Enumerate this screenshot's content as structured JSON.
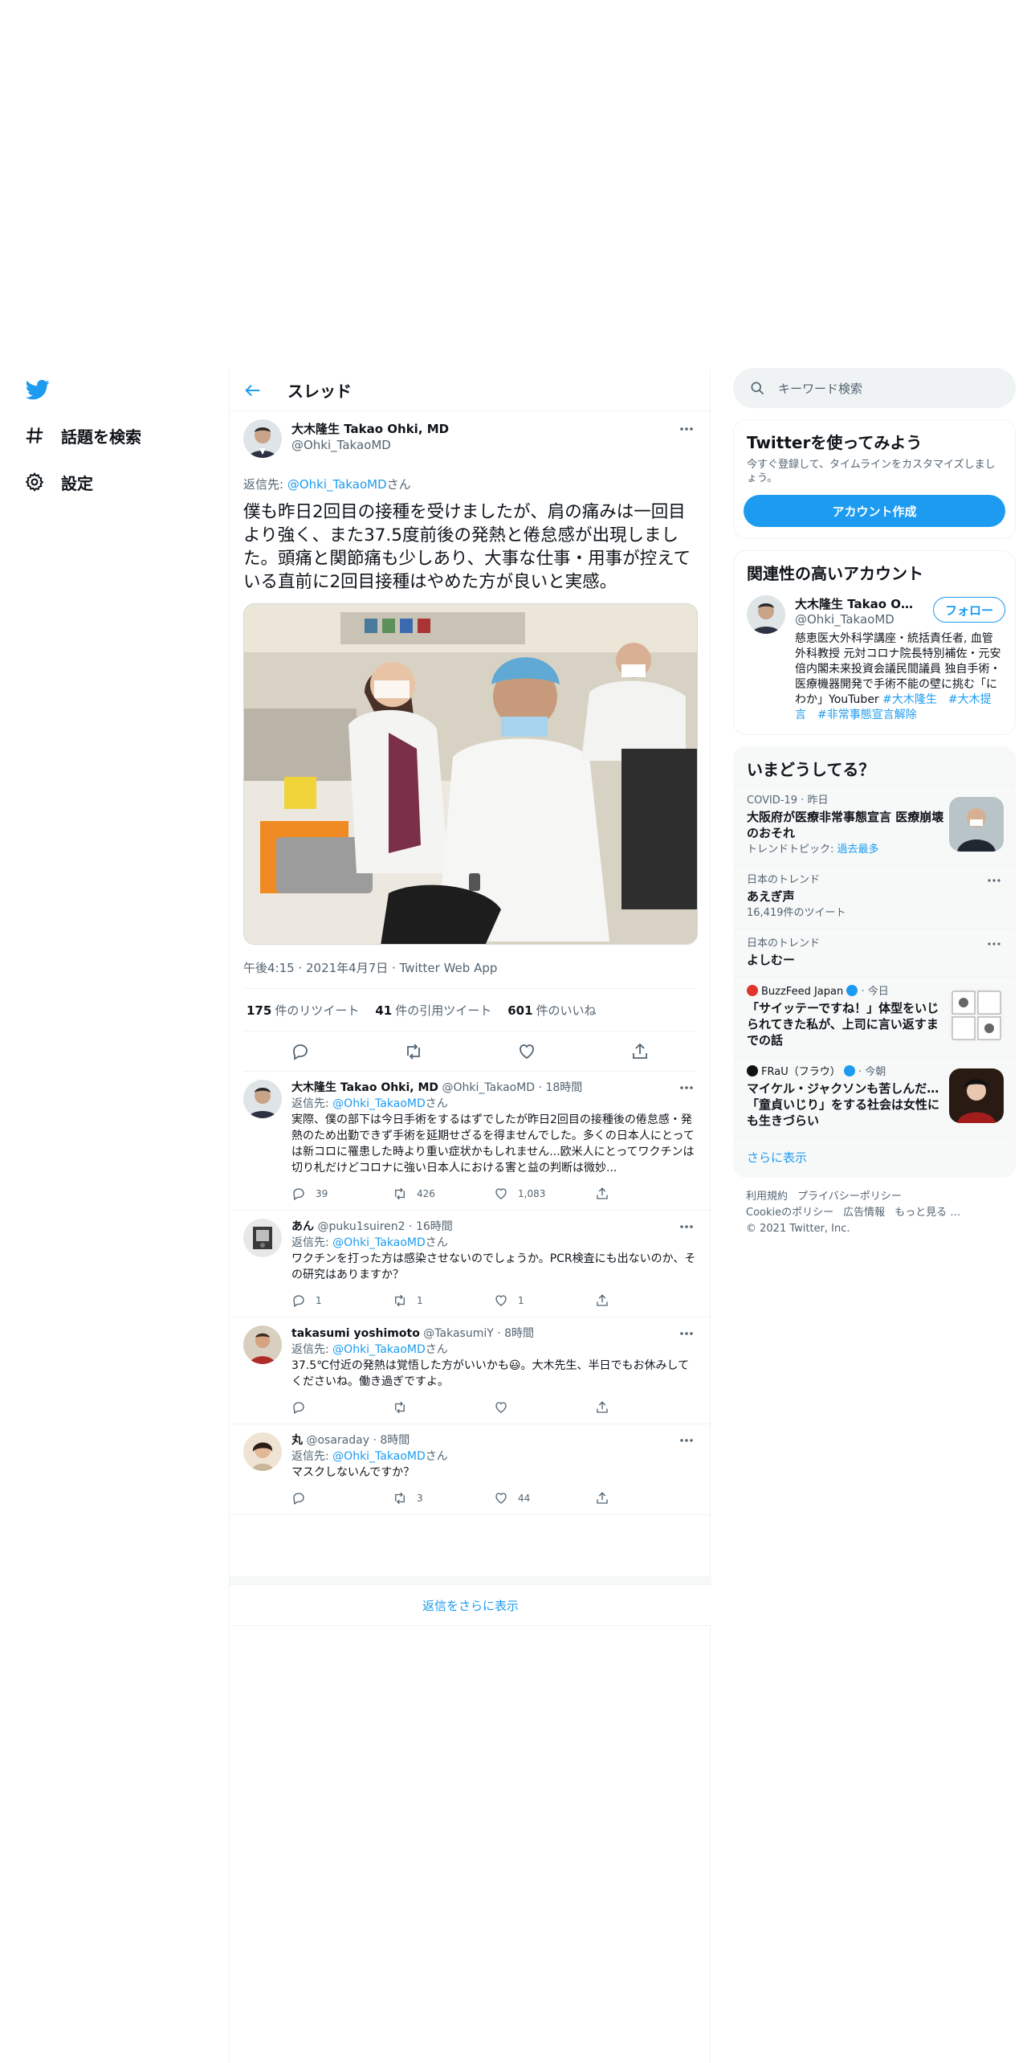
{
  "nav": {
    "items": [
      {
        "label": "話題を検索",
        "icon": "hashtag-icon"
      },
      {
        "label": "設定",
        "icon": "gear-icon"
      }
    ]
  },
  "header": {
    "title": "スレッド"
  },
  "main_tweet": {
    "display_name": "大木隆生 Takao Ohki, MD",
    "username": "@Ohki_TakaoMD",
    "reply_to_prefix": "返信先: ",
    "reply_to_user": "@Ohki_TakaoMD",
    "reply_to_suffix": "さん",
    "text": "僕も昨日2回目の接種を受けましたが、肩の痛みは一回目より強く、また37.5度前後の発熱と倦怠感が出現しました。頭痛と関節痛も少しあり、大事な仕事・用事が控えている直前に2回目接種はやめた方が良いと実感。",
    "meta": "午後4:15 · 2021年4月7日 · Twitter Web App",
    "retweets": "175",
    "retweets_label": "件のリツイート",
    "quotes": "41",
    "quotes_label": "件の引用ツイート",
    "likes": "601",
    "likes_label": "件のいいね"
  },
  "replies": [
    {
      "display_name": "大木隆生 Takao Ohki, MD",
      "username": "@Ohki_TakaoMD",
      "time": "18時間",
      "reply_to": "@Ohki_TakaoMD",
      "text": "実際、僕の部下は今日手術をするはずでしたが昨日2回目の接種後の倦怠感・発熱のため出勤できず手術を延期せざるを得ませんでした。多くの日本人にとっては新コロに罹患した時より重い症状かもしれません...欧米人にとってワクチンは切り札だけどコロナに強い日本人における害と益の判断は微妙...",
      "replies": "39",
      "retweets": "426",
      "likes": "1,083"
    },
    {
      "display_name": "あん",
      "username": "@puku1suiren2",
      "time": "16時間",
      "reply_to": "@Ohki_TakaoMD",
      "text": "ワクチンを打った方は感染させないのでしょうか。PCR検査にも出ないのか、その研究はありますか？",
      "replies": "1",
      "retweets": "1",
      "likes": "1"
    },
    {
      "display_name": "takasumi yoshimoto",
      "username": "@TakasumiY",
      "time": "8時間",
      "reply_to": "@Ohki_TakaoMD",
      "text": "37.5℃付近の発熱は覚悟した方がいいかも😃。大木先生、半日でもお休みしてくださいね。働き過ぎですよ。",
      "replies": "",
      "retweets": "",
      "likes": ""
    },
    {
      "display_name": "丸",
      "username": "@osaraday",
      "time": "8時間",
      "reply_to": "@Ohki_TakaoMD",
      "text": "マスクしないんですか？",
      "replies": "",
      "retweets": "3",
      "likes": "44"
    }
  ],
  "reply_to_prefix": "返信先: ",
  "reply_to_suffix": "さん",
  "show_more_replies": "返信をさらに表示",
  "search": {
    "placeholder": "キーワード検索"
  },
  "signup": {
    "title": "Twitterを使ってみよう",
    "text": "今すぐ登録して、タイムラインをカスタマイズしましょう。",
    "button": "アカウント作成"
  },
  "related": {
    "title": "関連性の高いアカウント",
    "display_name": "大木隆生 Takao Ohki...",
    "username": "@Ohki_TakaoMD",
    "follow": "フォロー",
    "bio": "慈恵医大外科学講座・統括責任者, 血管外科教授 元対コロナ院長特別補佐・元安倍内閣未来投資会議民間議員 独自手術・医療機器開発で手術不能の壁に挑む「にわか」YouTuber ",
    "hashtags": [
      "#大木隆生",
      "#大木提言",
      "#非常事態宣言解除"
    ]
  },
  "trends": {
    "title": "いまどうしてる？",
    "items": [
      {
        "category": "COVID-19 · 昨日",
        "title": "大阪府が医療非常事態宣言 医療崩壊のおそれ",
        "extra_prefix": "トレンドトピック: ",
        "extra_link": "過去最多"
      },
      {
        "category": "日本のトレンド",
        "title": "あえぎ声",
        "count": "16,419件のツイート"
      },
      {
        "category": "日本のトレンド",
        "title": "よしむー"
      },
      {
        "source": "BuzzFeed Japan",
        "time": " · 今日",
        "title": "「サイッテーですね！」体型をいじられてきた私が、上司に言い返すまでの話"
      },
      {
        "source": "FRaU（フラウ）",
        "time": " · 今朝",
        "title": "マイケル・ジャクソンも苦しんだ…「童貞いじり」をする社会は女性にも生きづらい"
      }
    ],
    "show_more": "さらに表示"
  },
  "footer": {
    "links": [
      "利用規約",
      "プライバシーポリシー",
      "Cookieのポリシー",
      "広告情報",
      "もっと見る …"
    ],
    "copyright": "© 2021 Twitter, Inc."
  },
  "colors": {
    "accent": "#1d9bf0",
    "text": "#0f1419",
    "muted": "#536471"
  }
}
